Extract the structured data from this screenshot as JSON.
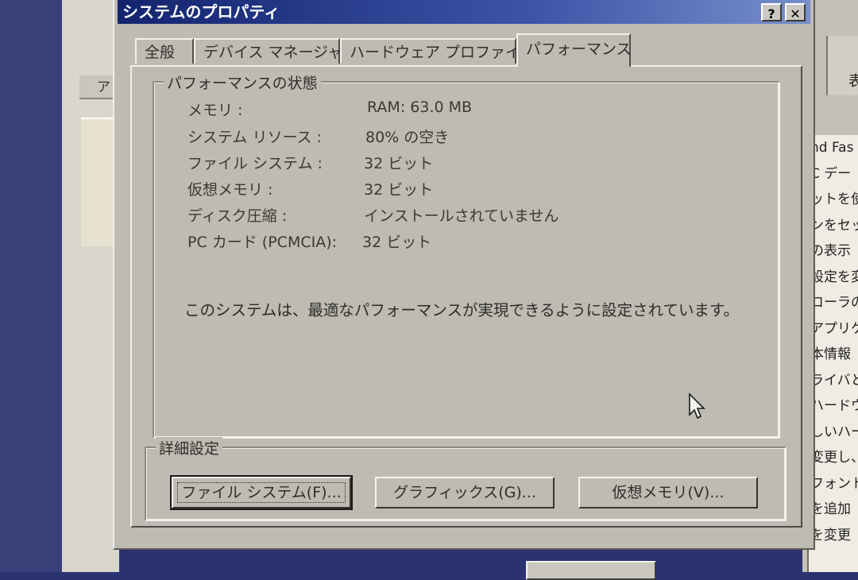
{
  "dialog": {
    "title": "システムのプロパティ",
    "help_label": "?",
    "close_label": "✕"
  },
  "tabs": [
    {
      "label": "全般"
    },
    {
      "label": "デバイス マネージャ"
    },
    {
      "label": "ハードウェア プロファイル"
    },
    {
      "label": "パフォーマンス"
    }
  ],
  "performance": {
    "group_title": "パフォーマンスの状態",
    "rows": [
      {
        "label": "メモリ :",
        "value": "RAM: 63.0 MB"
      },
      {
        "label": "システム リソース :",
        "value": "80% の空き"
      },
      {
        "label": "ファイル システム :",
        "value": "32 ビット"
      },
      {
        "label": "仮想メモリ :",
        "value": "32 ビット"
      },
      {
        "label": "ディスク圧縮 :",
        "value": "インストールされていません"
      },
      {
        "label": "PC カード (PCMCIA):",
        "value": "32 ビット"
      }
    ],
    "message": "このシステムは、最適なパフォーマンスが実現できるように設定されています。"
  },
  "advanced": {
    "group_title": "詳細設定",
    "buttons": [
      {
        "label": "ファイル システム(F)..."
      },
      {
        "label": "グラフィックス(G)..."
      },
      {
        "label": "仮想メモリ(V)..."
      }
    ]
  },
  "background": {
    "left_toolbar": "ア",
    "right_toolbar": "表",
    "right_lines": [
      "nd Fas",
      "C デー",
      "ットを使",
      "ンをセッ",
      "の表示",
      "設定を変",
      "コーラの",
      "アプリケ",
      "本情報",
      "ライバと",
      "ハードウ",
      "しいハー",
      "変更し、",
      "フォント",
      "を追加",
      "を変更"
    ]
  }
}
